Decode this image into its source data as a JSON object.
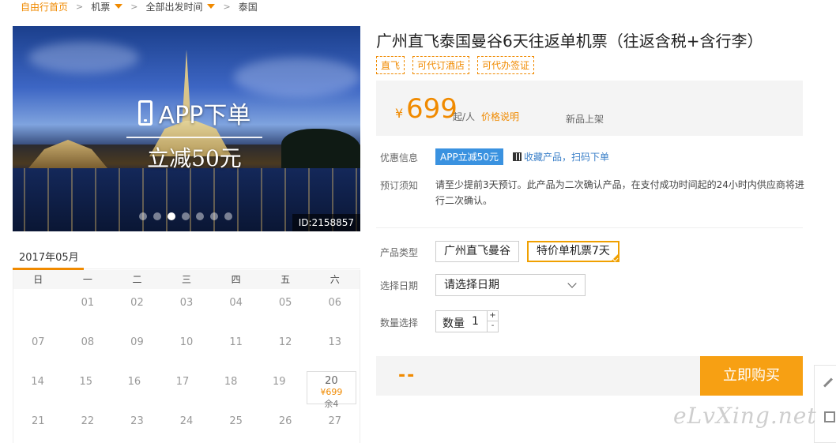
{
  "breadcrumb": {
    "home": "自由行首页",
    "crumb1": "机票",
    "crumb2": "全部出发时间",
    "crumb3": "泰国",
    "sep": ">"
  },
  "hero": {
    "app_title": "APP下单",
    "app_sub": "立减50元",
    "id_tag": "ID:2158857",
    "dots_count": 7,
    "active_dot": 3
  },
  "calendar": {
    "month": "2017年05月",
    "weekdays": [
      "日",
      "一",
      "二",
      "三",
      "四",
      "五",
      "六"
    ],
    "rows": [
      [
        "",
        "01",
        "02",
        "03",
        "04",
        "05",
        "06"
      ],
      [
        "07",
        "08",
        "09",
        "10",
        "11",
        "12",
        "13"
      ],
      [
        "14",
        "15",
        "16",
        "17",
        "18",
        "19",
        "20"
      ],
      [
        "21",
        "22",
        "23",
        "24",
        "25",
        "26",
        "27"
      ]
    ],
    "priced_day": {
      "day": "20",
      "price": "¥699",
      "remain": "余4"
    }
  },
  "product": {
    "title": "广州直飞泰国曼谷6天往返单机票（往返含税+含行李）",
    "tags": [
      "直飞",
      "可代订酒店",
      "可代办签证"
    ],
    "price": {
      "currency": "¥",
      "amount": "699",
      "per": "起/人",
      "explain": "价格说明",
      "status": "新品上架"
    },
    "promo": {
      "label": "优惠信息",
      "badge": "APP立减50元",
      "link1": "收藏产品",
      "link_sep": "，",
      "link2": "扫码下单"
    },
    "notice": {
      "label": "预订须知",
      "text": "请至少提前3天预订。此产品为二次确认产品，在支付成功时间起的24小时内供应商将进行二次确认。"
    },
    "type": {
      "label": "产品类型",
      "options": [
        "广州直飞曼谷",
        "特价单机票7天"
      ],
      "selected_index": 1
    },
    "date": {
      "label": "选择日期",
      "placeholder": "请选择日期"
    },
    "quantity": {
      "label": "数量选择",
      "field_label": "数量",
      "value": "1",
      "plus": "+",
      "minus": "-"
    },
    "buy": {
      "total": "--",
      "button": "立即购买"
    }
  },
  "watermark": "eLvXing.net",
  "colors": {
    "accent": "#f08a00",
    "buy_button": "#f7a013",
    "promo_badge": "#3a92e0",
    "link": "#3a7fc8"
  }
}
